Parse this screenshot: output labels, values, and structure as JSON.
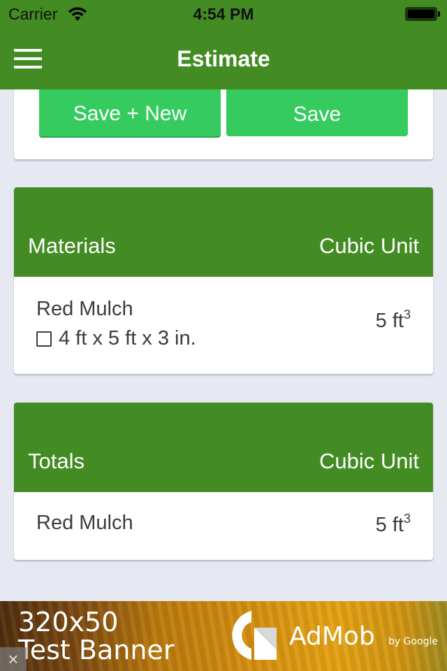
{
  "status_bar": {
    "carrier": "Carrier",
    "time": "4:54 PM",
    "icons": [
      "wifi-icon",
      "battery-icon"
    ]
  },
  "nav": {
    "title": "Estimate",
    "menu_icon": "hamburger-menu-icon"
  },
  "actions": {
    "save_new_label": "Save + New",
    "save_label": "Save"
  },
  "materials": {
    "header_left": "Materials",
    "header_right": "Cubic Unit",
    "items": [
      {
        "name": "Red Mulch",
        "dimensions": "4 ft x 5 ft x 3 in.",
        "checked": false,
        "quantity": "5 ft",
        "unit_exponent": "3"
      }
    ]
  },
  "totals": {
    "header_left": "Totals",
    "header_right": "Cubic Unit",
    "items": [
      {
        "name": "Red Mulch",
        "quantity": "5 ft",
        "unit_exponent": "3"
      }
    ]
  },
  "ad": {
    "line1": "320x50",
    "line2": "Test Banner",
    "brand": "AdMob",
    "by": "by Google",
    "close": "×"
  },
  "colors": {
    "primary_green": "#438b23",
    "button_green": "#35cb5f",
    "background": "#e6e9f1",
    "text_dark": "#3c3c3c"
  }
}
